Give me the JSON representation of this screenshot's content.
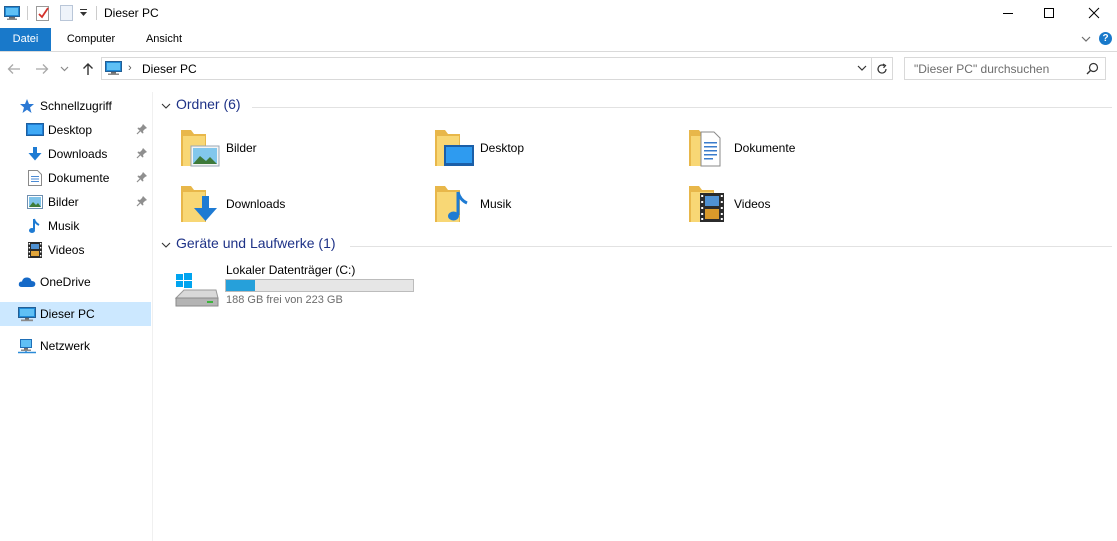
{
  "window": {
    "title": "Dieser PC"
  },
  "ribbon": {
    "tabs": [
      {
        "label": "Datei"
      },
      {
        "label": "Computer"
      },
      {
        "label": "Ansicht"
      }
    ],
    "help_label": "?"
  },
  "address": {
    "location": "Dieser PC",
    "search_placeholder": "\"Dieser PC\" durchsuchen"
  },
  "sidebar": {
    "items": [
      {
        "label": "Schnellzugriff",
        "icon": "star-icon"
      },
      {
        "label": "Desktop",
        "icon": "desktop-icon",
        "pinned": true
      },
      {
        "label": "Downloads",
        "icon": "download-arrow-icon",
        "pinned": true
      },
      {
        "label": "Dokumente",
        "icon": "document-icon",
        "pinned": true
      },
      {
        "label": "Bilder",
        "icon": "picture-icon",
        "pinned": true
      },
      {
        "label": "Musik",
        "icon": "music-note-icon"
      },
      {
        "label": "Videos",
        "icon": "film-icon"
      },
      {
        "label": "OneDrive",
        "icon": "cloud-icon"
      },
      {
        "label": "Dieser PC",
        "icon": "computer-icon",
        "selected": true
      },
      {
        "label": "Netzwerk",
        "icon": "network-icon"
      }
    ]
  },
  "content": {
    "folders_header": "Ordner (6)",
    "folders": [
      {
        "label": "Bilder",
        "icon": "pictures-folder-icon"
      },
      {
        "label": "Desktop",
        "icon": "desktop-folder-icon"
      },
      {
        "label": "Dokumente",
        "icon": "documents-folder-icon"
      },
      {
        "label": "Downloads",
        "icon": "downloads-folder-icon"
      },
      {
        "label": "Musik",
        "icon": "music-folder-icon"
      },
      {
        "label": "Videos",
        "icon": "videos-folder-icon"
      }
    ],
    "drives_header": "Geräte und Laufwerke (1)",
    "drives": [
      {
        "name": "Lokaler Datenträger (C:)",
        "free_text": "188 GB frei von 223 GB",
        "used_fraction": 0.157,
        "icon": "hard-drive-icon"
      }
    ]
  },
  "colors": {
    "accent": "#1979ca",
    "selection": "#cce8ff",
    "group_header": "#1e3287",
    "drive_bar": "#26a0da",
    "folder": "#f8d775"
  }
}
